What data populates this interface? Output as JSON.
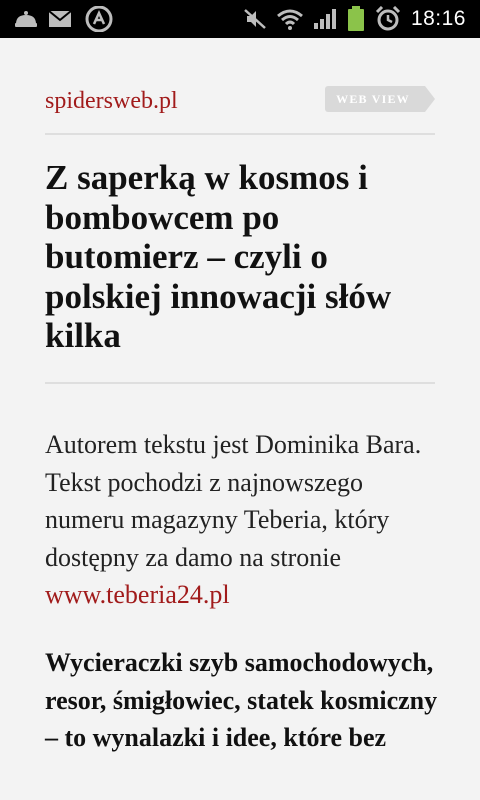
{
  "status_bar": {
    "time": "18:16",
    "icons": [
      "app-notification-icon",
      "mail-icon",
      "a-app-icon",
      "mute-icon",
      "wifi-icon",
      "signal-icon",
      "battery-icon",
      "alarm-icon"
    ]
  },
  "article": {
    "source": "spidersweb.pl",
    "web_view_label": "WEB VIEW",
    "title": "Z saperką w kosmos i bombowcem po butomierz – czyli o polskiej innowacji słów kilka",
    "intro_text": "Autorem tekstu jest Dominika Bara. Tekst pochodzi z najnowszego numeru magazyny Teberia, który dostępny za damo na stronie ",
    "intro_link": "www.teberia24.pl",
    "lead_text": "Wycieraczki szyb samochodowych, resor, śmigłowiec, statek kosmiczny – to wynalazki i idee, które bez"
  },
  "colors": {
    "link": "#a11b1b",
    "background": "#f3f3f3",
    "statusbar": "#000000",
    "web_view_button": "#d9d9d9",
    "battery": "#8bc34a"
  }
}
